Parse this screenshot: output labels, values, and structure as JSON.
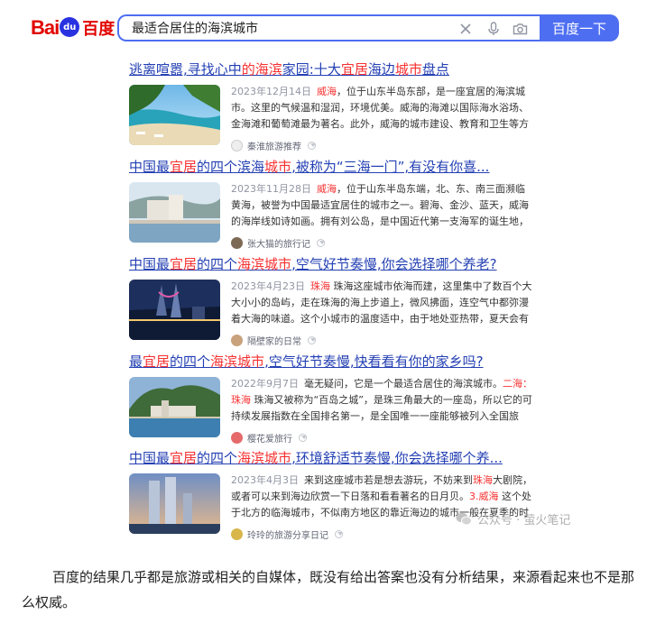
{
  "header": {
    "logo": {
      "bai": "Bai",
      "paw": "du",
      "du": "百度"
    },
    "search": {
      "query": "最适合居住的海滨城市"
    },
    "icons": {
      "clear": "close-icon",
      "voice": "microphone-icon",
      "image": "camera-icon"
    },
    "search_button": "百度一下"
  },
  "results": [
    {
      "title": [
        [
          "逃离喧嚣,寻找心中",
          0
        ],
        [
          "的海滨",
          1
        ],
        [
          "家园:十大",
          0
        ],
        [
          "宜居",
          1
        ],
        [
          "海边",
          0
        ],
        [
          "城市",
          1
        ],
        [
          "盘点",
          0
        ]
      ],
      "date": "2023年12月14日",
      "snippet": [
        [
          "威海",
          1
        ],
        [
          "，位于山东半岛东部，是一座宜居的海滨城市。这里的气候温和湿润，环境优美。威海的海滩以国际海水浴场、金海滩和葡萄滩最为著名。此外，威海的城市建设、教育和卫生等方面都...",
          0
        ]
      ],
      "source": "秦淮旅游推荐"
    },
    {
      "title": [
        [
          "中国最",
          0
        ],
        [
          "宜居",
          1
        ],
        [
          "的四个滨海",
          0
        ],
        [
          "城市",
          1
        ],
        [
          ",被称为“三海一门”,有没有你喜...",
          0
        ]
      ],
      "date": "2023年11月28日",
      "snippet": [
        [
          "威海",
          1
        ],
        [
          "，位于山东半岛东端，北、东、南三面濒临黄海，被誉为中国最适宜居住的城市之一。碧海、金沙、蓝天，威海的海岸线如诗如画。拥有刘公岛，是中国近代第一支海军的诞生地，这座...",
          0
        ]
      ],
      "source": "张大猫的旅行记"
    },
    {
      "title": [
        [
          "中国最",
          0
        ],
        [
          "宜居",
          1
        ],
        [
          "的四个",
          0
        ],
        [
          "海滨城市",
          1
        ],
        [
          ",空气好节奏慢,你会选择哪个养老?",
          0
        ]
      ],
      "date": "2023年4月23日",
      "snippet": [
        [
          "珠海",
          1
        ],
        [
          " 珠海这座城市依海而建，这里集中了数百个大大小小的岛屿，走在珠海的海上步道上，微风拂面，连空气中都弥漫着大海的味道。这个小城市的温度适中，由于地处亚热带，夏天会有点...",
          0
        ]
      ],
      "source": "隔壁家的日常"
    },
    {
      "title": [
        [
          "最",
          0
        ],
        [
          "宜居",
          1
        ],
        [
          "的四个",
          0
        ],
        [
          "海滨城市",
          1
        ],
        [
          ",空气好节奏慢,快看看有你的家乡吗?",
          0
        ]
      ],
      "date": "2022年9月7日",
      "snippet": [
        [
          "毫无疑问，它是一个最适合居住的海滨城市。",
          0
        ],
        [
          "二海：珠海",
          1
        ],
        [
          " 珠海又被称为“百岛之城”，是珠三角最大的一座岛，所以它的可持续发展指数在全国排名第一，是全国唯一一座能够被列入全国旅游...",
          0
        ]
      ],
      "source": "樱花爱旅行"
    },
    {
      "title": [
        [
          "中国最",
          0
        ],
        [
          "宜居",
          1
        ],
        [
          "的四个",
          0
        ],
        [
          "海滨城市",
          1
        ],
        [
          ",环境舒适节奏慢,你会选择哪个养...",
          0
        ]
      ],
      "date": "2023年4月3日",
      "snippet": [
        [
          "来到这座城市若是想去游玩，不妨来到",
          0
        ],
        [
          "珠海",
          1
        ],
        [
          "大剧院，或者可以来到海边欣赏一下日落和看看著名的日月贝。",
          0
        ],
        [
          "3.威海",
          1
        ],
        [
          " 这个处于北方的临海城市，不似南方地区的靠近海边的城市一般在夏季的时候...",
          0
        ]
      ],
      "source": "玲玲的旅游分享日记"
    }
  ],
  "watermark": "公众号 · 萤火笔记",
  "article": "百度的结果几乎都是旅游或相关的自媒体，既没有给出答案也没有分析结果，来源看起来也不是那么权威。",
  "colors": {
    "accent": "#4e6ef2",
    "link": "#2440b3",
    "highlight": "#f73131",
    "logo_red": "#e10601",
    "logo_blue": "#2932e1"
  }
}
